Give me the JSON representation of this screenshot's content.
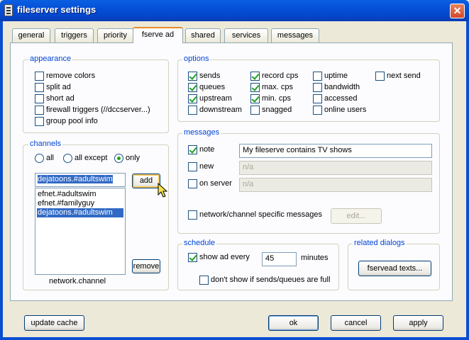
{
  "window": {
    "title": "fileserver settings",
    "close_glyph": "✕"
  },
  "tabs": [
    "general",
    "triggers",
    "priority",
    "fserve ad",
    "shared",
    "services",
    "messages"
  ],
  "appearance": {
    "legend": "appearance",
    "items": [
      {
        "label": "remove colors",
        "checked": false
      },
      {
        "label": "split ad",
        "checked": false
      },
      {
        "label": "short ad",
        "checked": false
      },
      {
        "label": "firewall triggers (//dccserver...)",
        "checked": false
      },
      {
        "label": "group pool info",
        "checked": false
      }
    ]
  },
  "channels": {
    "legend": "channels",
    "radios": [
      {
        "label": "all",
        "selected": false
      },
      {
        "label": "all except",
        "selected": false
      },
      {
        "label": "only",
        "selected": true
      }
    ],
    "input_value": "dejatoons.#adultswim",
    "add_label": "add",
    "list": [
      "efnet.#adultswim",
      "efnet.#familyguy",
      "dejatoons.#adultswim"
    ],
    "selected_index": 2,
    "remove_label": "remove",
    "caption": "network.channel"
  },
  "options": {
    "legend": "options",
    "items": [
      {
        "label": "sends",
        "checked": true
      },
      {
        "label": "queues",
        "checked": true
      },
      {
        "label": "upstream",
        "checked": true
      },
      {
        "label": "downstream",
        "checked": false
      },
      {
        "label": "record cps",
        "checked": true
      },
      {
        "label": "max. cps",
        "checked": true
      },
      {
        "label": "min. cps",
        "checked": true
      },
      {
        "label": "snagged",
        "checked": false
      },
      {
        "label": "uptime",
        "checked": false
      },
      {
        "label": "bandwidth",
        "checked": false
      },
      {
        "label": "accessed",
        "checked": false
      },
      {
        "label": "online users",
        "checked": false
      },
      {
        "label": "next send",
        "checked": false
      }
    ]
  },
  "messages": {
    "legend": "messages",
    "note": {
      "label": "note",
      "checked": true,
      "value": "My fileserve contains TV shows"
    },
    "new": {
      "label": "new",
      "checked": false,
      "value": "n/a"
    },
    "on_server": {
      "label": "on server",
      "checked": false,
      "value": "n/a"
    },
    "specific": {
      "label": "network/channel specific messages",
      "checked": false
    },
    "edit_label": "edit..."
  },
  "schedule": {
    "legend": "schedule",
    "show_label": "show ad every",
    "show_checked": true,
    "minutes_value": "45",
    "minutes_label": "minutes",
    "dont_show_label": "don't show if sends/queues are full",
    "dont_show_checked": false
  },
  "related": {
    "legend": "related dialogs",
    "button_label": "fservead texts..."
  },
  "footer": {
    "update_label": "update cache",
    "ok_label": "ok",
    "cancel_label": "cancel",
    "apply_label": "apply"
  }
}
